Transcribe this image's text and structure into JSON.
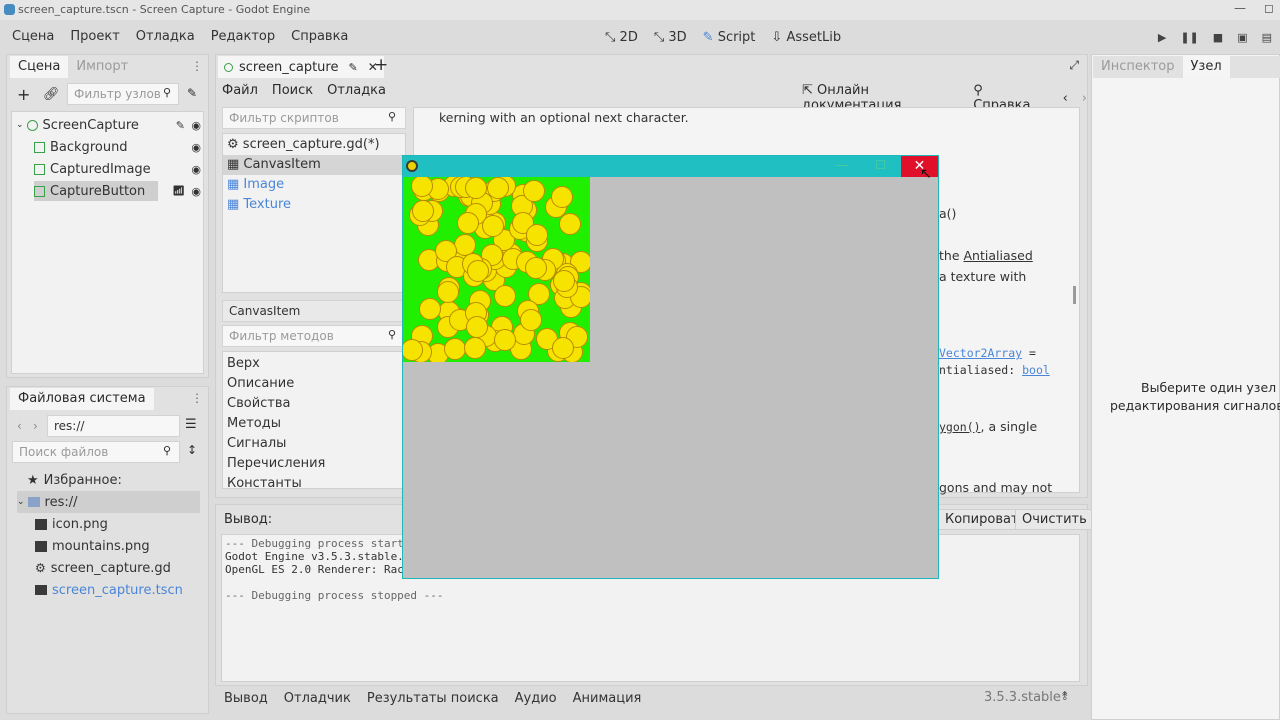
{
  "window": {
    "title": "screen_capture.tscn - Screen Capture - Godot Engine"
  },
  "menu": [
    "Сцена",
    "Проект",
    "Отладка",
    "Редактор",
    "Справка"
  ],
  "workspaces": [
    "2D",
    "3D",
    "Script",
    "AssetLib"
  ],
  "scene_dock": {
    "tabs": [
      "Сцена",
      "Импорт"
    ],
    "filter_placeholder": "Фильтр узлов",
    "nodes": [
      {
        "name": "ScreenCapture"
      },
      {
        "name": "Background"
      },
      {
        "name": "CapturedImage"
      },
      {
        "name": "CaptureButton"
      }
    ]
  },
  "fs_dock": {
    "title": "Файловая система",
    "path": "res://",
    "search_placeholder": "Поиск файлов",
    "favorites": "Избранное:",
    "root": "res://",
    "files": [
      "icon.png",
      "mountains.png",
      "screen_capture.gd",
      "screen_capture.tscn"
    ]
  },
  "script_tab": {
    "label": "screen_capture"
  },
  "script_menu": [
    "Файл",
    "Поиск",
    "Отладка"
  ],
  "doc_links": {
    "online": "Онлайн документация",
    "help": "Справка"
  },
  "scripts_filter": "Фильтр скриптов",
  "scripts": [
    "screen_capture.gd(*)",
    "CanvasItem",
    "Image",
    "Texture"
  ],
  "class_name": "CanvasItem",
  "methods_filter": "Фильтр методов",
  "methods": [
    "Верх",
    "Описание",
    "Свойства",
    "Методы",
    "Сигналы",
    "Перечисления",
    "Константы"
  ],
  "doc": {
    "line1": "kerning with an optional next character.",
    "l2": "a()",
    "l3a": "the ",
    "l3b": "Antialiased",
    "l4": "a texture with",
    "l5a": "Vector2Array",
    "l5b": " =",
    "l6a": "ntialiased: ",
    "l6b": "bool",
    "l7a": "ygon()",
    "l7b": ", a single",
    "l8": "gons and may not"
  },
  "output": {
    "label": "Вывод:",
    "copy": "Копировать",
    "clear": "Очистить",
    "lines": [
      "--- Debugging process start",
      "Godot Engine v3.5.3.stable.",
      "OpenGL ES 2.0 Renderer: Rac",
      "",
      "--- Debugging process stopped ---"
    ]
  },
  "bottom_tabs": [
    "Вывод",
    "Отладчик",
    "Результаты поиска",
    "Аудио",
    "Анимация"
  ],
  "version": "3.5.3.stable",
  "inspector": {
    "tabs": [
      "Инспектор",
      "Узел"
    ],
    "message_line1": "Выберите один узел для",
    "message_line2": "редактирования сигналов и г"
  },
  "colors": {
    "accent": "#4a86d8",
    "game_titlebar": "#1fbfc2",
    "close": "#e0102a",
    "canvas_bg": "#20f000",
    "smiley": "#f6e400"
  }
}
